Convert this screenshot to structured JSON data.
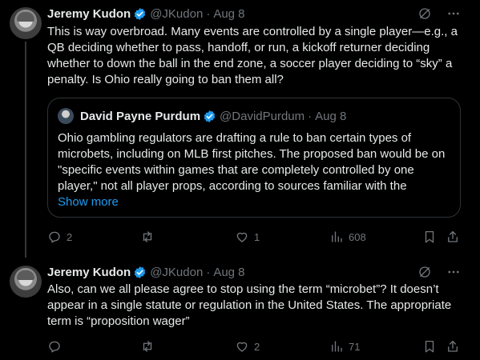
{
  "tweets": [
    {
      "name": "Jeremy Kudon",
      "handle": "@JKudon",
      "separator": "·",
      "date": "Aug 8",
      "text": "This is way overbroad. Many events are controlled by a single player—e.g., a QB  deciding whether to pass, handoff, or run, a kickoff returner deciding whether to down the ball in the end zone, a soccer player deciding to “sky” a penalty. Is Ohio really going to ban them all?",
      "quote": {
        "name": "David Payne Purdum",
        "handle": "@DavidPurdum",
        "separator": "·",
        "date": "Aug 8",
        "text": "Ohio gambling regulators are drafting a rule to ban certain types of microbets, including on MLB first pitches. The proposed ban would be on \"specific events within games that are completely controlled by one player,\" not all player props, according to sources familiar with the",
        "show_more": "Show more"
      },
      "stats": {
        "replies": "2",
        "reposts": "",
        "likes": "1",
        "views": "608"
      }
    },
    {
      "name": "Jeremy Kudon",
      "handle": "@JKudon",
      "separator": "·",
      "date": "Aug 8",
      "text": "Also, can we all please agree to stop using the term “microbet”? It doesn’t appear in a single statute or regulation in the United States. The appropriate term is “proposition wager”",
      "stats": {
        "replies": "",
        "reposts": "",
        "likes": "2",
        "views": "71"
      }
    }
  ],
  "colors": {
    "background": "#000000",
    "text": "#e7e9ea",
    "muted": "#71767b",
    "link": "#1d9bf0",
    "verified": "#1d9bf0",
    "border": "#2f3336"
  },
  "icons": [
    "verified-badge-icon",
    "grok-icon",
    "more-icon",
    "reply-icon",
    "repost-icon",
    "like-icon",
    "views-icon",
    "bookmark-icon",
    "share-icon"
  ]
}
